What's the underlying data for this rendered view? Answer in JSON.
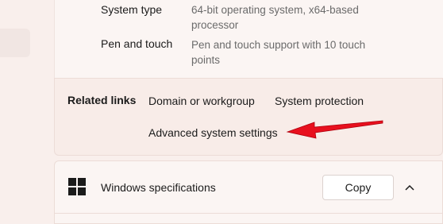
{
  "device_specs": {
    "rows": [
      {
        "label": "System type",
        "value": "64-bit operating system, x64-based processor"
      },
      {
        "label": "Pen and touch",
        "value": "Pen and touch support with 10 touch points"
      }
    ]
  },
  "related_links": {
    "title": "Related links",
    "links": [
      "Domain or workgroup",
      "System protection",
      "Advanced system settings"
    ]
  },
  "windows_specs": {
    "title": "Windows specifications",
    "copy_label": "Copy",
    "icon": "windows-logo-icon",
    "expand_icon": "chevron-up-icon"
  },
  "colors": {
    "background": "#f9efec",
    "card": "#fbf5f3",
    "accent_arrow": "#e8101e"
  }
}
